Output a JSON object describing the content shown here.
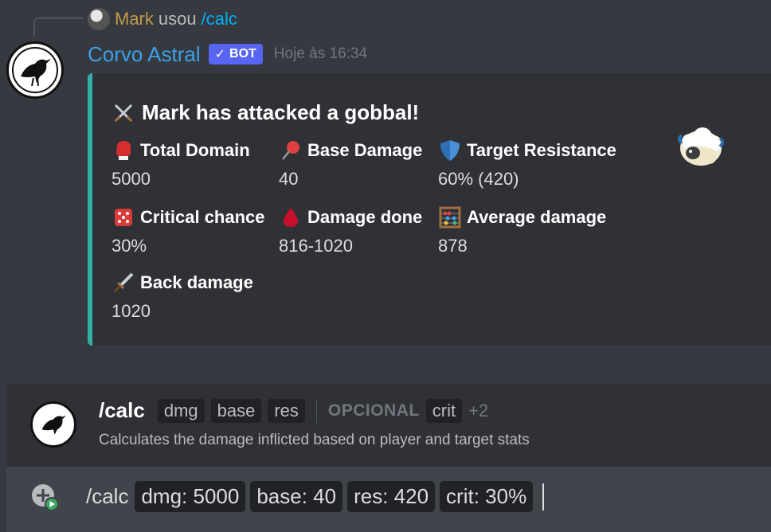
{
  "reply": {
    "user": "Mark",
    "verb": "usou",
    "command": "/calc"
  },
  "message": {
    "author": "Corvo Astral",
    "bot_tag": "BOT",
    "timestamp": "Hoje às 16:34"
  },
  "embed": {
    "accent_color": "#33b1a6",
    "title": "Mark has attacked a gobbal!",
    "fields": [
      {
        "icon": "boxing-glove-icon",
        "name": "Total Domain",
        "value": "5000"
      },
      {
        "icon": "pushpin-icon",
        "name": "Base Damage",
        "value": "40"
      },
      {
        "icon": "shield-icon",
        "name": "Target Resistance",
        "value": "60% (420)"
      },
      {
        "icon": "dice-icon",
        "name": "Critical chance",
        "value": "30%"
      },
      {
        "icon": "drop-of-blood-icon",
        "name": "Damage done",
        "value": "816-1020"
      },
      {
        "icon": "abacus-icon",
        "name": "Average damage",
        "value": "878"
      },
      {
        "icon": "dagger-icon",
        "name": "Back damage",
        "value": "1020"
      }
    ]
  },
  "command_preview": {
    "name": "/calc",
    "options": [
      "dmg",
      "base",
      "res"
    ],
    "optional_label": "OPCIONAL",
    "optional_options": [
      "crit"
    ],
    "more": "+2",
    "description": "Calculates the damage inflicted based on player and target stats"
  },
  "input": {
    "command": "/calc",
    "chips": [
      "dmg: 5000",
      "base: 40",
      "res: 420",
      "crit: 30%"
    ]
  }
}
